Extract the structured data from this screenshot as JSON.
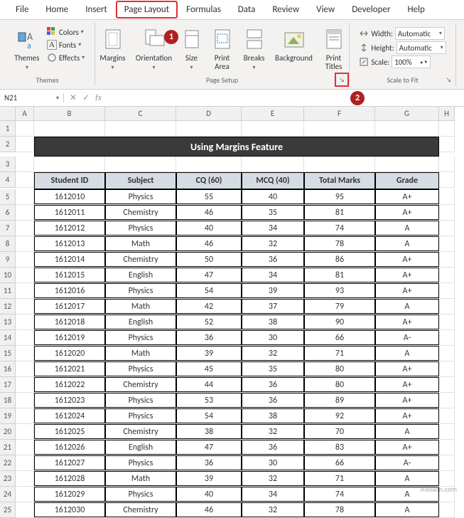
{
  "tabs": [
    "File",
    "Home",
    "Insert",
    "Page Layout",
    "Formulas",
    "Data",
    "Review",
    "View",
    "Developer",
    "Help"
  ],
  "active_tab": "Page Layout",
  "themes_group": {
    "label": "Themes",
    "themes_label": "Themes",
    "colors_label": "Colors",
    "fonts_label": "Fonts",
    "effects_label": "Effects"
  },
  "page_setup_group": {
    "label": "Page Setup",
    "margins_label": "Margins",
    "orientation_label": "Orientation",
    "size_label": "Size",
    "print_area_label": "Print\nArea",
    "breaks_label": "Breaks",
    "background_label": "Background",
    "print_titles_label": "Print\nTitles"
  },
  "scale_group": {
    "label": "Scale to Fit",
    "width_label": "Width:",
    "height_label": "Height:",
    "scale_label": "Scale:",
    "width_val": "Automatic",
    "height_val": "Automatic",
    "scale_val": "100%"
  },
  "name_box": "N21",
  "callout_1": "1",
  "callout_2": "2",
  "columns": [
    "A",
    "B",
    "C",
    "D",
    "E",
    "F",
    "G",
    "H"
  ],
  "title": "Using Margins Feature",
  "headers": [
    "Student ID",
    "Subject",
    "CQ  (60)",
    "MCQ (40)",
    "Total Marks",
    "Grade"
  ],
  "rows": [
    [
      "1612010",
      "Physics",
      "55",
      "40",
      "95",
      "A+"
    ],
    [
      "1612011",
      "Chemistry",
      "46",
      "35",
      "81",
      "A+"
    ],
    [
      "1612012",
      "Physics",
      "40",
      "34",
      "74",
      "A"
    ],
    [
      "1612013",
      "Math",
      "46",
      "32",
      "78",
      "A"
    ],
    [
      "1612014",
      "Chemistry",
      "50",
      "36",
      "86",
      "A+"
    ],
    [
      "1612015",
      "English",
      "47",
      "34",
      "81",
      "A+"
    ],
    [
      "1612016",
      "Physics",
      "54",
      "39",
      "93",
      "A+"
    ],
    [
      "1612017",
      "Math",
      "42",
      "37",
      "79",
      "A"
    ],
    [
      "1612018",
      "English",
      "52",
      "38",
      "90",
      "A+"
    ],
    [
      "1612019",
      "Physics",
      "36",
      "30",
      "66",
      "A-"
    ],
    [
      "1612020",
      "Math",
      "39",
      "32",
      "71",
      "A"
    ],
    [
      "1612021",
      "Physics",
      "45",
      "35",
      "80",
      "A+"
    ],
    [
      "1612022",
      "Chemistry",
      "44",
      "36",
      "80",
      "A+"
    ],
    [
      "1612023",
      "Physics",
      "53",
      "36",
      "89",
      "A+"
    ],
    [
      "1612024",
      "Physics",
      "54",
      "38",
      "92",
      "A+"
    ],
    [
      "1612025",
      "Chemistry",
      "38",
      "32",
      "70",
      "A"
    ],
    [
      "1612026",
      "English",
      "47",
      "36",
      "83",
      "A+"
    ],
    [
      "1612027",
      "Physics",
      "36",
      "30",
      "66",
      "A-"
    ],
    [
      "1612028",
      "Math",
      "39",
      "32",
      "71",
      "A"
    ],
    [
      "1612029",
      "Physics",
      "40",
      "34",
      "74",
      "A"
    ],
    [
      "1612030",
      "Chemistry",
      "46",
      "32",
      "78",
      "A"
    ]
  ],
  "watermark": "Awsxdn.com"
}
